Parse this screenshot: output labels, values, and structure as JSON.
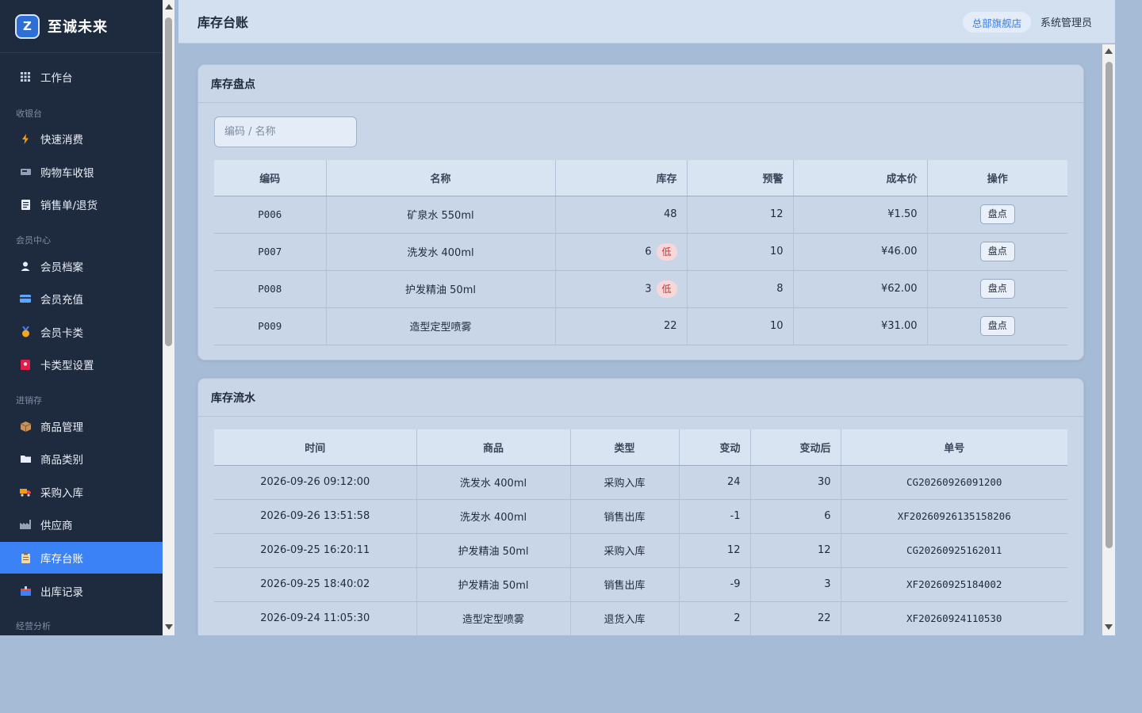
{
  "brand": {
    "logo_letter": "Z",
    "name": "至诚未来"
  },
  "sidebar": {
    "workbench": "工作台",
    "groups": [
      {
        "label": "收银台",
        "items": [
          "快速消费",
          "购物车收银",
          "销售单/退货"
        ]
      },
      {
        "label": "会员中心",
        "items": [
          "会员档案",
          "会员充值",
          "会员卡类",
          "卡类型设置"
        ]
      },
      {
        "label": "进销存",
        "items": [
          "商品管理",
          "商品类别",
          "采购入库",
          "供应商",
          "库存台账",
          "出库记录"
        ]
      },
      {
        "label": "经营分析",
        "items": []
      }
    ],
    "active": "库存台账"
  },
  "header": {
    "title": "库存台账",
    "store": "总部旗舰店",
    "user": "系统管理员"
  },
  "inventory": {
    "title": "库存盘点",
    "search_placeholder": "编码 / 名称",
    "columns": [
      "编码",
      "名称",
      "库存",
      "预警",
      "成本价",
      "操作"
    ],
    "low_label": "低",
    "action_label": "盘点",
    "rows": [
      {
        "code": "P006",
        "name": "矿泉水 550ml",
        "stock": "48",
        "low": false,
        "alert": "12",
        "cost": "¥1.50"
      },
      {
        "code": "P007",
        "name": "洗发水 400ml",
        "stock": "6",
        "low": true,
        "alert": "10",
        "cost": "¥46.00"
      },
      {
        "code": "P008",
        "name": "护发精油 50ml",
        "stock": "3",
        "low": true,
        "alert": "8",
        "cost": "¥62.00"
      },
      {
        "code": "P009",
        "name": "造型定型喷雾",
        "stock": "22",
        "low": false,
        "alert": "10",
        "cost": "¥31.00"
      }
    ]
  },
  "flow": {
    "title": "库存流水",
    "columns": [
      "时间",
      "商品",
      "类型",
      "变动",
      "变动后",
      "单号"
    ],
    "rows": [
      {
        "time": "2026-09-26 09:12:00",
        "product": "洗发水 400ml",
        "type": "采购入库",
        "change": "24",
        "after": "30",
        "no": "CG20260926091200"
      },
      {
        "time": "2026-09-26 13:51:58",
        "product": "洗发水 400ml",
        "type": "销售出库",
        "change": "-1",
        "after": "6",
        "no": "XF20260926135158206"
      },
      {
        "time": "2026-09-25 16:20:11",
        "product": "护发精油 50ml",
        "type": "采购入库",
        "change": "12",
        "after": "12",
        "no": "CG20260925162011"
      },
      {
        "time": "2026-09-25 18:40:02",
        "product": "护发精油 50ml",
        "type": "销售出库",
        "change": "-9",
        "after": "3",
        "no": "XF20260925184002"
      },
      {
        "time": "2026-09-24 11:05:30",
        "product": "造型定型喷雾",
        "type": "退货入库",
        "change": "2",
        "after": "22",
        "no": "XF20260924110530"
      }
    ]
  }
}
